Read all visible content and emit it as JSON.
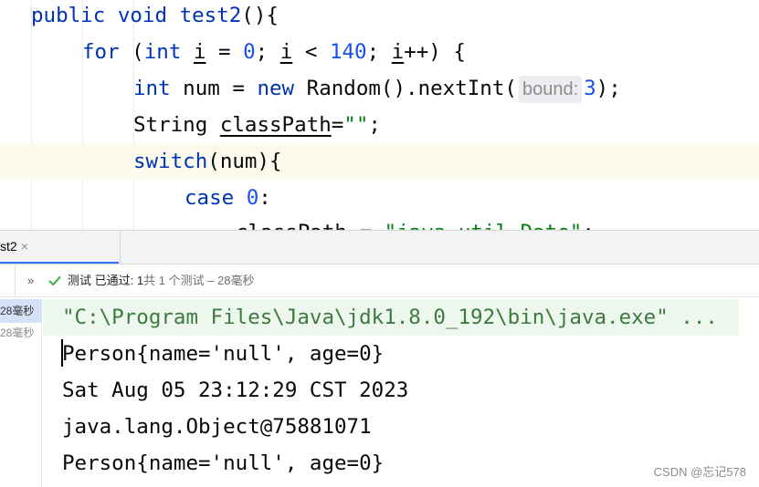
{
  "editor": {
    "lines": [
      {
        "t1": "public void ",
        "t2": "test2",
        "t3": "(){"
      },
      {
        "kw": "for",
        "a": " (",
        "b": "int ",
        "v1": "i",
        "c": " = ",
        "n1": "0",
        "d": "; ",
        "v2": "i",
        "e": " < ",
        "n2": "140",
        "f": "; ",
        "v3": "i",
        "g": "++) {"
      },
      {
        "kw": "int",
        "a": " num = ",
        "kw2": "new",
        "b": " Random().nextInt(",
        "hint": "bound:",
        "n": "3",
        "c": ");"
      },
      {
        "a": "String ",
        "v": "classPath",
        "b": "=",
        "s": "\"\"",
        "c": ";"
      },
      {
        "kw": "switch",
        "a": "(num){"
      },
      {
        "kw": "case ",
        "n": "0",
        "a": ":"
      },
      {
        "a": "classPath = ",
        "s": "\"java.util.Date\"",
        "b": ";"
      }
    ]
  },
  "tab": {
    "label": "st2",
    "close": "×"
  },
  "toolbar": {
    "chevron": "»",
    "status_prefix": "测试 已通过: ",
    "passed": "1",
    "status_suffix": "共 1 个测试 – 28毫秒"
  },
  "tree": {
    "items": [
      {
        "label": "28毫秒"
      },
      {
        "label": "28毫秒"
      }
    ]
  },
  "console": {
    "lines": [
      "\"C:\\Program Files\\Java\\jdk1.8.0_192\\bin\\java.exe\" ...",
      "Person{name='null', age=0}",
      "Sat Aug 05 23:12:29 CST 2023",
      "java.lang.Object@75881071",
      "Person{name='null', age=0}"
    ]
  },
  "watermark": "CSDN @忘记578",
  "colors": {
    "keyword": "#0033b3",
    "number": "#1750eb",
    "string": "#067d17",
    "pass": "#4caf50",
    "selection": "#d5e1f7"
  }
}
